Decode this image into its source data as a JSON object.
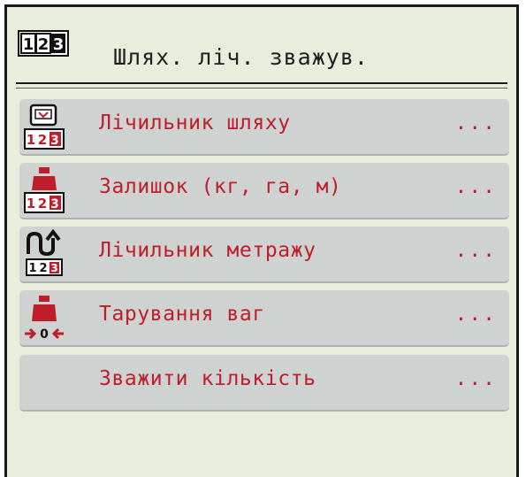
{
  "header": {
    "icon": "counter-icon",
    "title": "Шлях. ліч. зважув."
  },
  "menu": {
    "items": [
      {
        "label": "Лічильник шляху",
        "more": "...",
        "icon": "trip-counter-icon"
      },
      {
        "label": "Залишок (кг, га, м)",
        "more": "...",
        "icon": "remaining-weight-icon"
      },
      {
        "label": "Лічильник метражу",
        "more": "...",
        "icon": "meter-counter-icon"
      },
      {
        "label": "Тарування ваг",
        "more": "...",
        "icon": "tare-scale-icon"
      },
      {
        "label": "Зважити кількість",
        "more": "...",
        "icon": ""
      }
    ]
  },
  "colors": {
    "background": "#e9eddc",
    "item_background": "#ced2d0",
    "label": "#c01d2a",
    "header_text": "#1f1f1f"
  }
}
